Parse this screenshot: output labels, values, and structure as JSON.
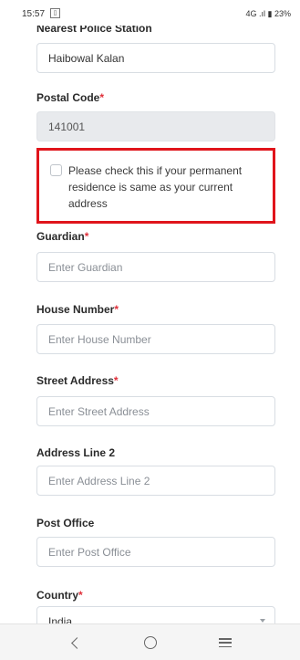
{
  "status_bar": {
    "time": "15:57",
    "sim_glyph": "▯",
    "right": "4G .ıl ▮ 23%"
  },
  "form": {
    "police_station_label": "Nearest Police Station",
    "police_station_value": "Haibowal Kalan",
    "postal_code_label": "Postal Code",
    "postal_code_value": "141001",
    "same_address_text": "Please check this if your permanent residence is same as your current address",
    "guardian_label": "Guardian",
    "guardian_placeholder": "Enter Guardian",
    "house_number_label": "House Number",
    "house_number_placeholder": "Enter House Number",
    "street_address_label": "Street Address",
    "street_address_placeholder": "Enter Street Address",
    "address_line2_label": "Address Line 2",
    "address_line2_placeholder": "Enter Address Line 2",
    "post_office_label": "Post Office",
    "post_office_placeholder": "Enter Post Office",
    "country_label": "Country",
    "country_value": "India",
    "required_mark": "*"
  },
  "colors": {
    "required": "#e0303a",
    "highlight_border": "#e0141b",
    "input_border": "#d8dde3",
    "disabled_bg": "#e8eaed"
  },
  "navbar": {
    "back_icon": "back-icon",
    "home_icon": "home-icon",
    "menu_icon": "menu-icon"
  }
}
